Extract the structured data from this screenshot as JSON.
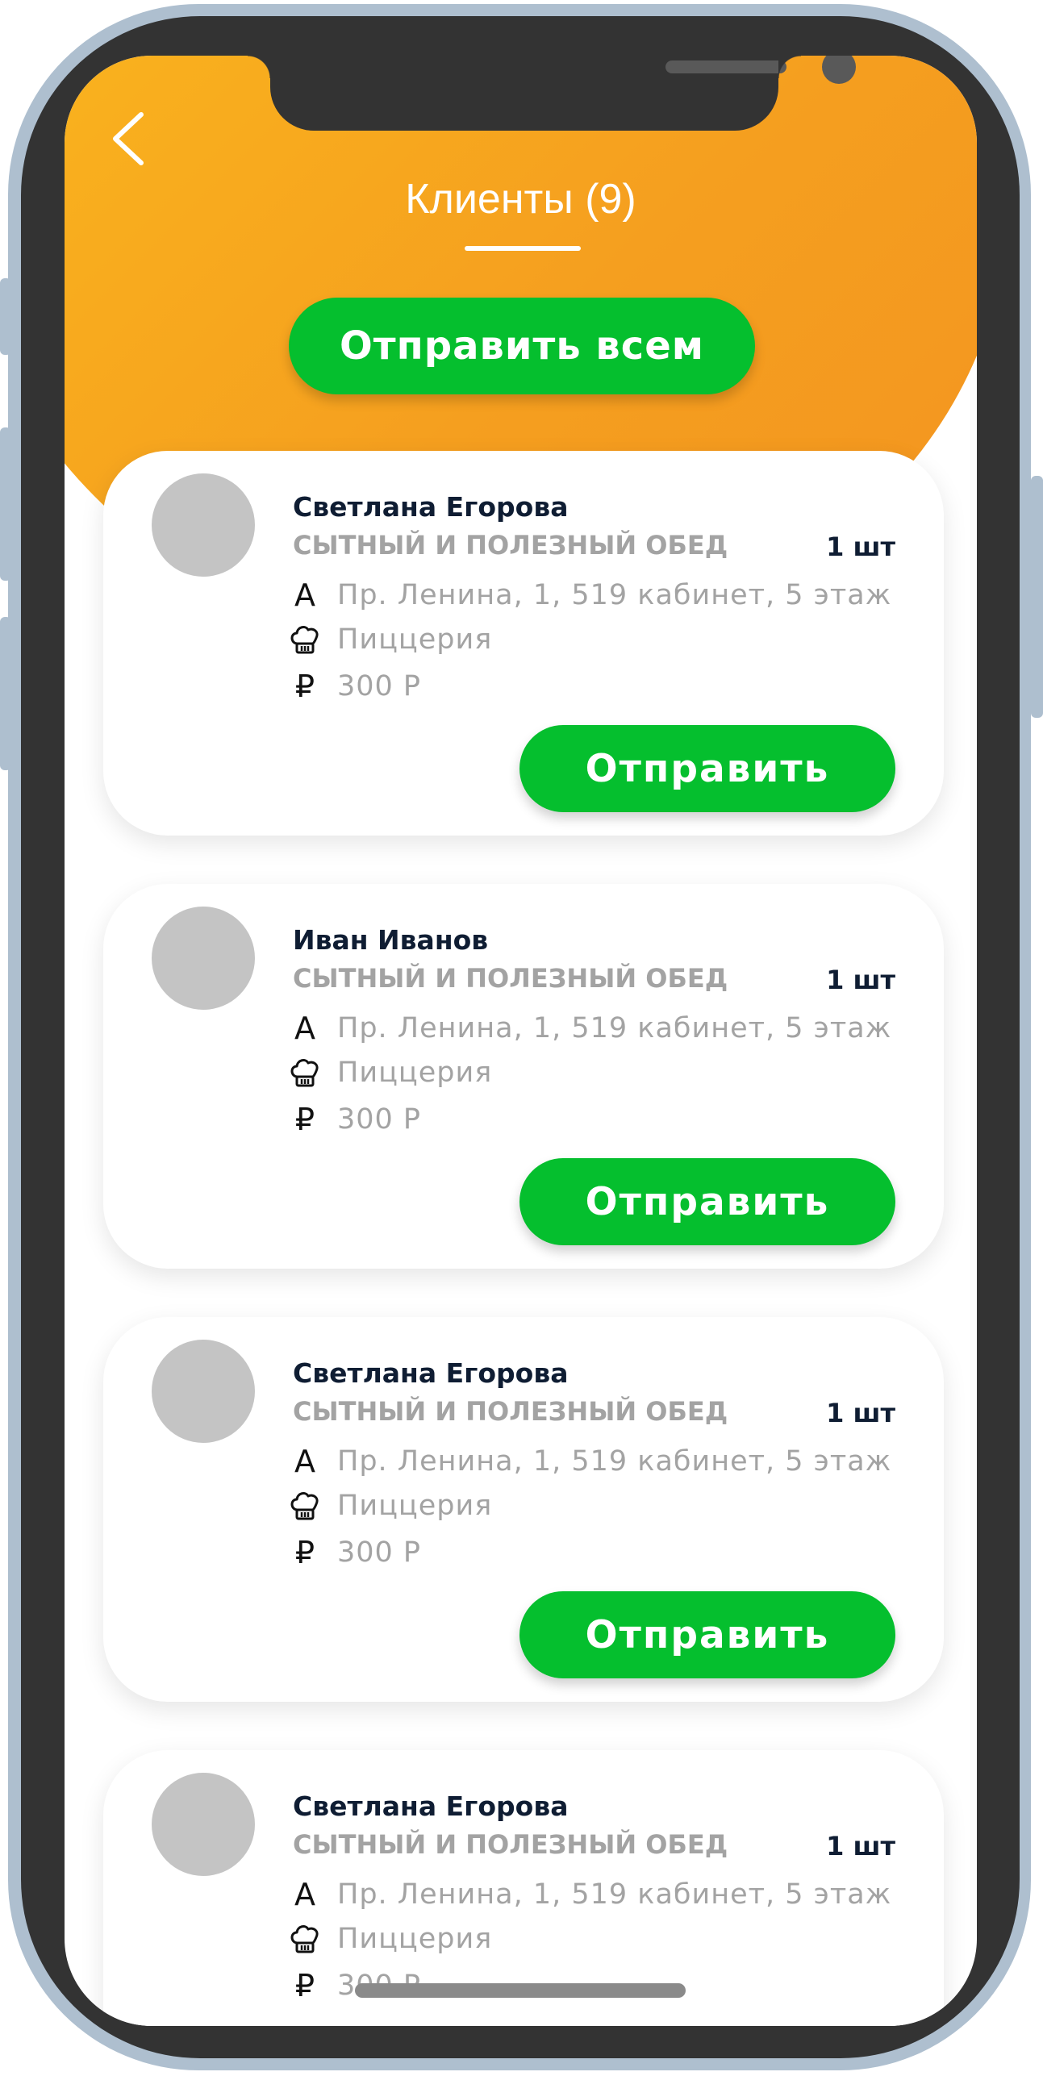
{
  "header": {
    "title": "Клиенты (9)",
    "send_all_label": "Отправить всем"
  },
  "clients": [
    {
      "name": "Светлана Егорова",
      "dish": "СЫТНЫЙ И ПОЛЕЗНЫЙ ОБЕД",
      "quantity": "1 шт",
      "address_icon": "А",
      "address": "Пр. Ленина, 1, 519 кабинет, 5 этаж",
      "place": "Пиццерия",
      "price_icon": "₽",
      "price": "300 Р",
      "send_label": "Отправить"
    },
    {
      "name": "Иван Иванов",
      "dish": "СЫТНЫЙ И ПОЛЕЗНЫЙ ОБЕД",
      "quantity": "1 шт",
      "address_icon": "А",
      "address": "Пр. Ленина, 1, 519 кабинет, 5 этаж",
      "place": "Пиццерия",
      "price_icon": "₽",
      "price": "300 Р",
      "send_label": "Отправить"
    },
    {
      "name": "Светлана Егорова",
      "dish": "СЫТНЫЙ И ПОЛЕЗНЫЙ ОБЕД",
      "quantity": "1 шт",
      "address_icon": "А",
      "address": "Пр. Ленина, 1, 519 кабинет, 5 этаж",
      "place": "Пиццерия",
      "price_icon": "₽",
      "price": "300 Р",
      "send_label": "Отправить"
    },
    {
      "name": "Светлана Егорова",
      "dish": "СЫТНЫЙ И ПОЛЕЗНЫЙ ОБЕД",
      "quantity": "1 шт",
      "address_icon": "А",
      "address": "Пр. Ленина, 1, 519 кабинет, 5 этаж",
      "place": "Пиццерия",
      "price_icon": "₽",
      "price": "300 Р"
    }
  ],
  "icons": {
    "back": "chevron-left-icon",
    "place": "chef-hat-icon"
  },
  "colors": {
    "accent_orange": "#f7a11e",
    "button_green": "#05bf2e",
    "frame": "#aebfcf",
    "bezel": "#333333",
    "avatar_placeholder": "#c4c4c4"
  }
}
